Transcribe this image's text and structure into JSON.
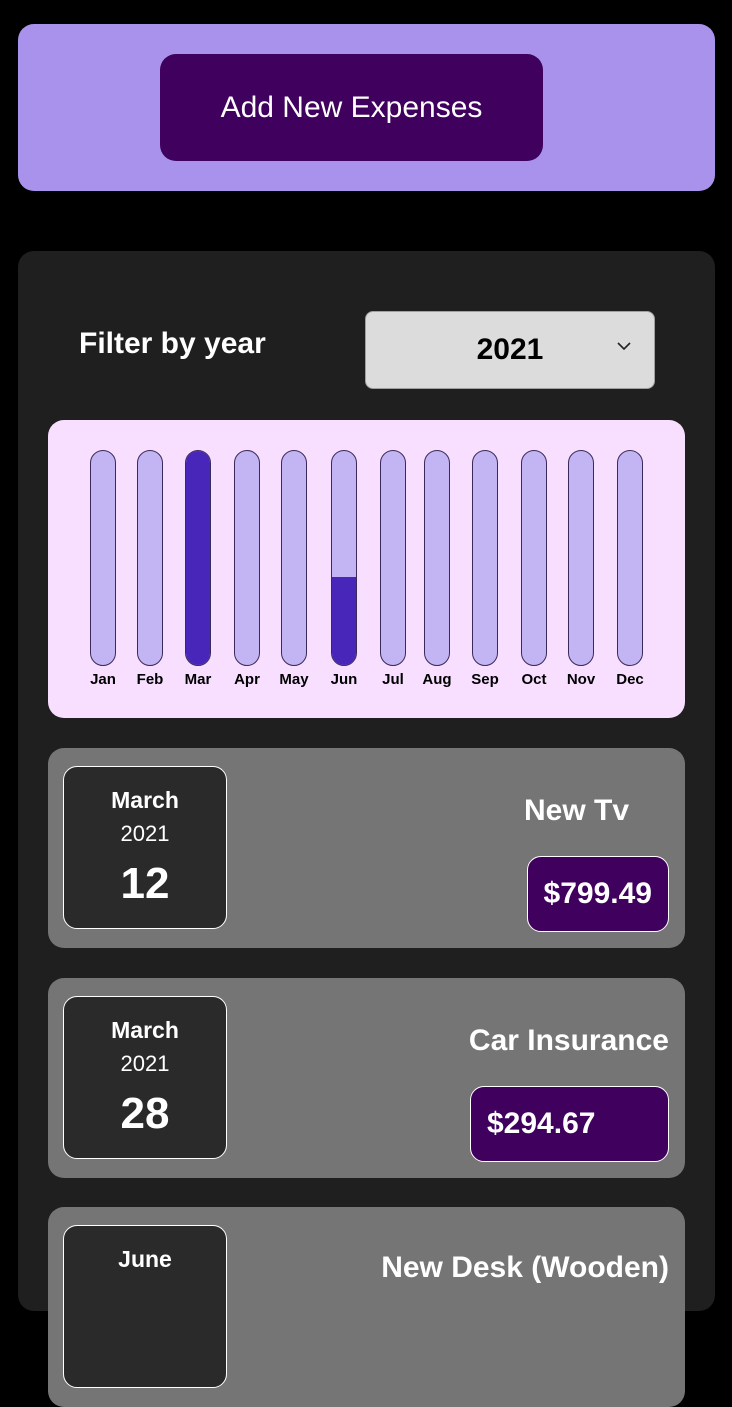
{
  "new_expense": {
    "button_label": "Add New Expenses"
  },
  "filter": {
    "label": "Filter by year",
    "selected_year": "2021"
  },
  "chart_data": {
    "type": "bar",
    "categories": [
      "Jan",
      "Feb",
      "Mar",
      "Apr",
      "May",
      "Jun",
      "Jul",
      "Aug",
      "Sep",
      "Oct",
      "Nov",
      "Dec"
    ],
    "values": [
      0,
      0,
      1094.16,
      0,
      0,
      0,
      0,
      0,
      0,
      0,
      0,
      0
    ],
    "fill_fraction": [
      0,
      0,
      1.0,
      0,
      0,
      0.41,
      0,
      0,
      0,
      0,
      0,
      0
    ],
    "ylim": [
      0,
      1
    ]
  },
  "colors": {
    "bar_fill": "#4826b9",
    "bar_track": "#c3b4f3",
    "price_bg": "#40005d",
    "header_bg": "#a892ec"
  },
  "expenses": [
    {
      "month": "March",
      "year": "2021",
      "day": "12",
      "title": "New Tv",
      "amount": "$799.49"
    },
    {
      "month": "March",
      "year": "2021",
      "day": "28",
      "title": "Car Insurance",
      "amount": "$294.67"
    },
    {
      "month": "June",
      "year": "",
      "day": "",
      "title": "New Desk (Wooden)",
      "amount": ""
    }
  ]
}
